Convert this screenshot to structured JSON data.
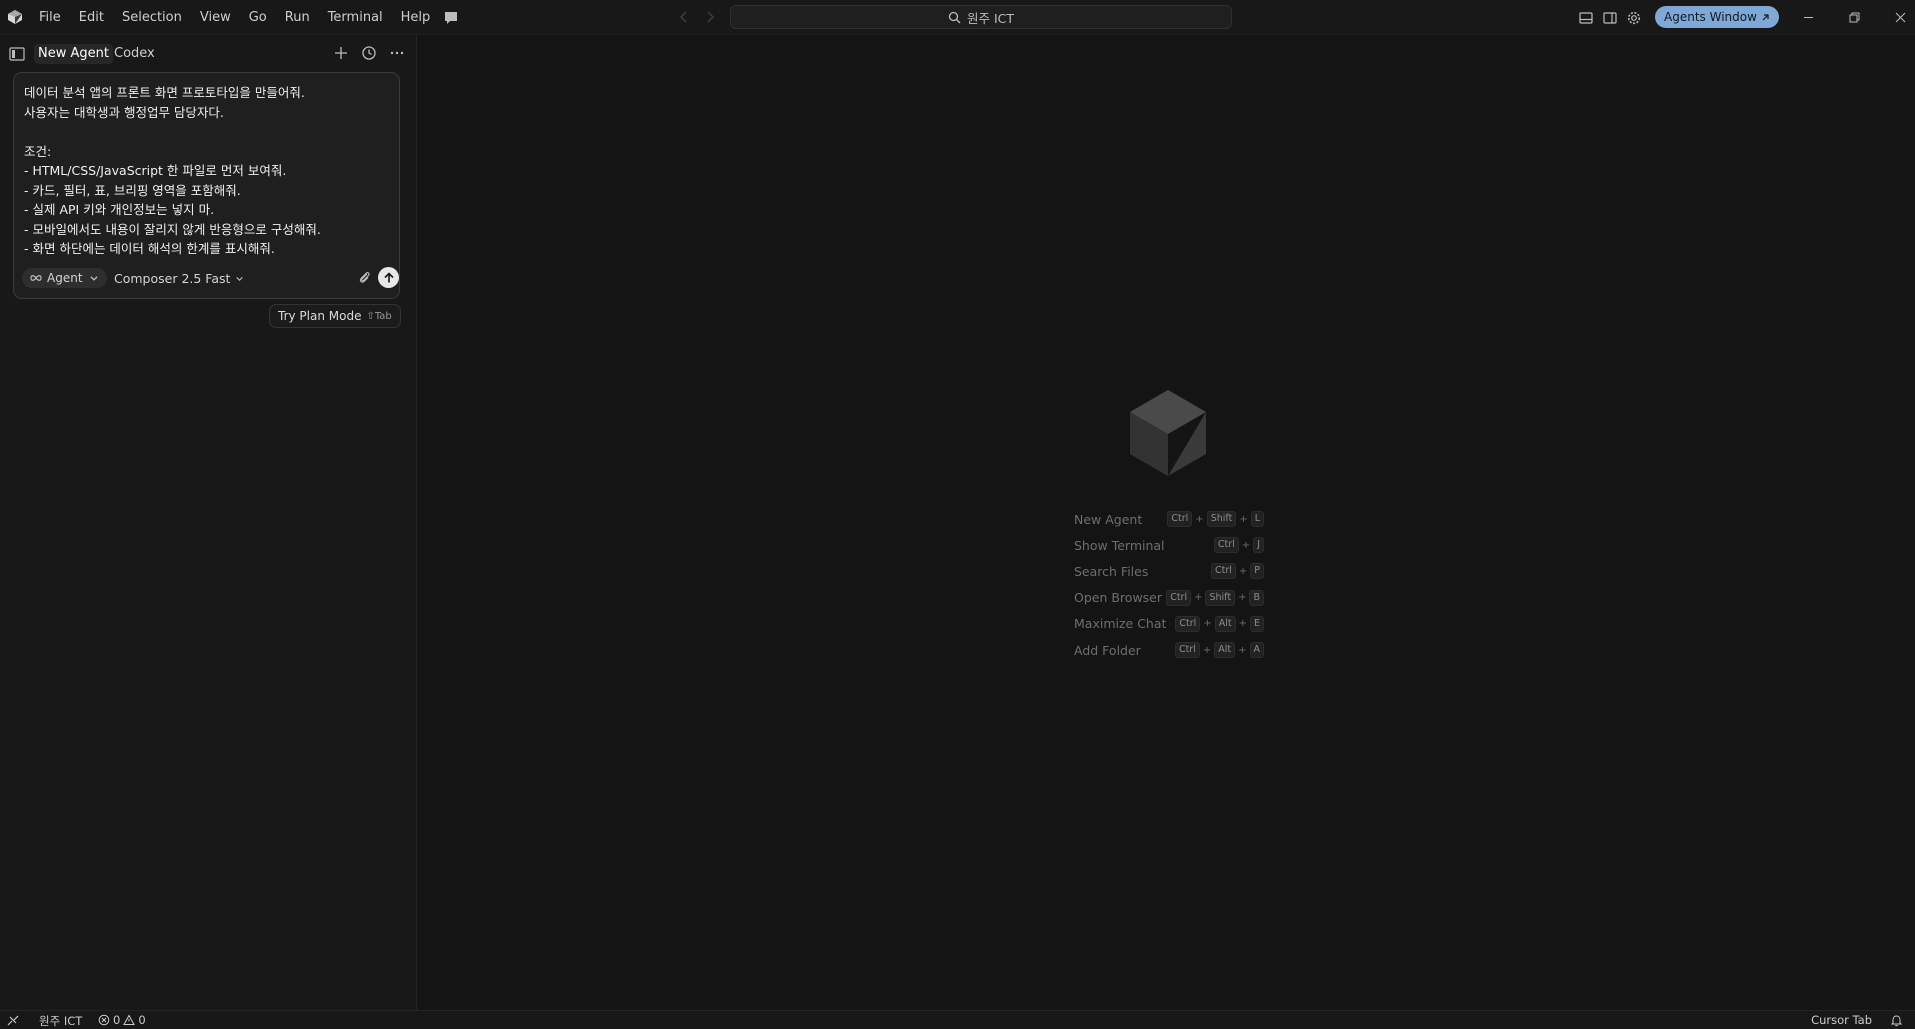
{
  "titlebar": {
    "menu": [
      "File",
      "Edit",
      "Selection",
      "View",
      "Go",
      "Run",
      "Terminal",
      "Help"
    ],
    "search_text": "원주 ICT",
    "agents_window_label": "Agents Window"
  },
  "left_panel": {
    "tabs": {
      "active": "New Agent",
      "second": "Codex"
    },
    "composer": {
      "prompt": "데이터 분석 앱의 프론트 화면 프로토타입을 만들어줘.\n사용자는 대학생과 행정업무 담당자다.\n\n조건:\n- HTML/CSS/JavaScript 한 파일로 먼저 보여줘.\n- 카드, 필터, 표, 브리핑 영역을 포함해줘.\n- 실제 API 키와 개인정보는 넣지 마.\n- 모바일에서도 내용이 잘리지 않게 반응형으로 구성해줘.\n- 화면 하단에는 데이터 해석의 한계를 표시해줘.",
      "mode_label": "Agent",
      "model_label": "Composer 2.5 Fast"
    },
    "plan_mode": {
      "label": "Try Plan Mode",
      "hint": "⇧Tab"
    }
  },
  "main": {
    "shortcuts": [
      {
        "label": "New Agent",
        "keys": [
          "Ctrl",
          "Shift",
          "L"
        ]
      },
      {
        "label": "Show Terminal",
        "keys": [
          "Ctrl",
          "J"
        ]
      },
      {
        "label": "Search Files",
        "keys": [
          "Ctrl",
          "P"
        ]
      },
      {
        "label": "Open Browser",
        "keys": [
          "Ctrl",
          "Shift",
          "B"
        ]
      },
      {
        "label": "Maximize Chat",
        "keys": [
          "Ctrl",
          "Alt",
          "E"
        ]
      },
      {
        "label": "Add Folder",
        "keys": [
          "Ctrl",
          "Alt",
          "A"
        ]
      }
    ]
  },
  "statusbar": {
    "folder": "원주 ICT",
    "errors": "0",
    "warnings": "0",
    "cursor_tab": "Cursor Tab"
  },
  "colors": {
    "accent": "#7fa8d6",
    "background": "#141414",
    "panel": "#181818"
  }
}
